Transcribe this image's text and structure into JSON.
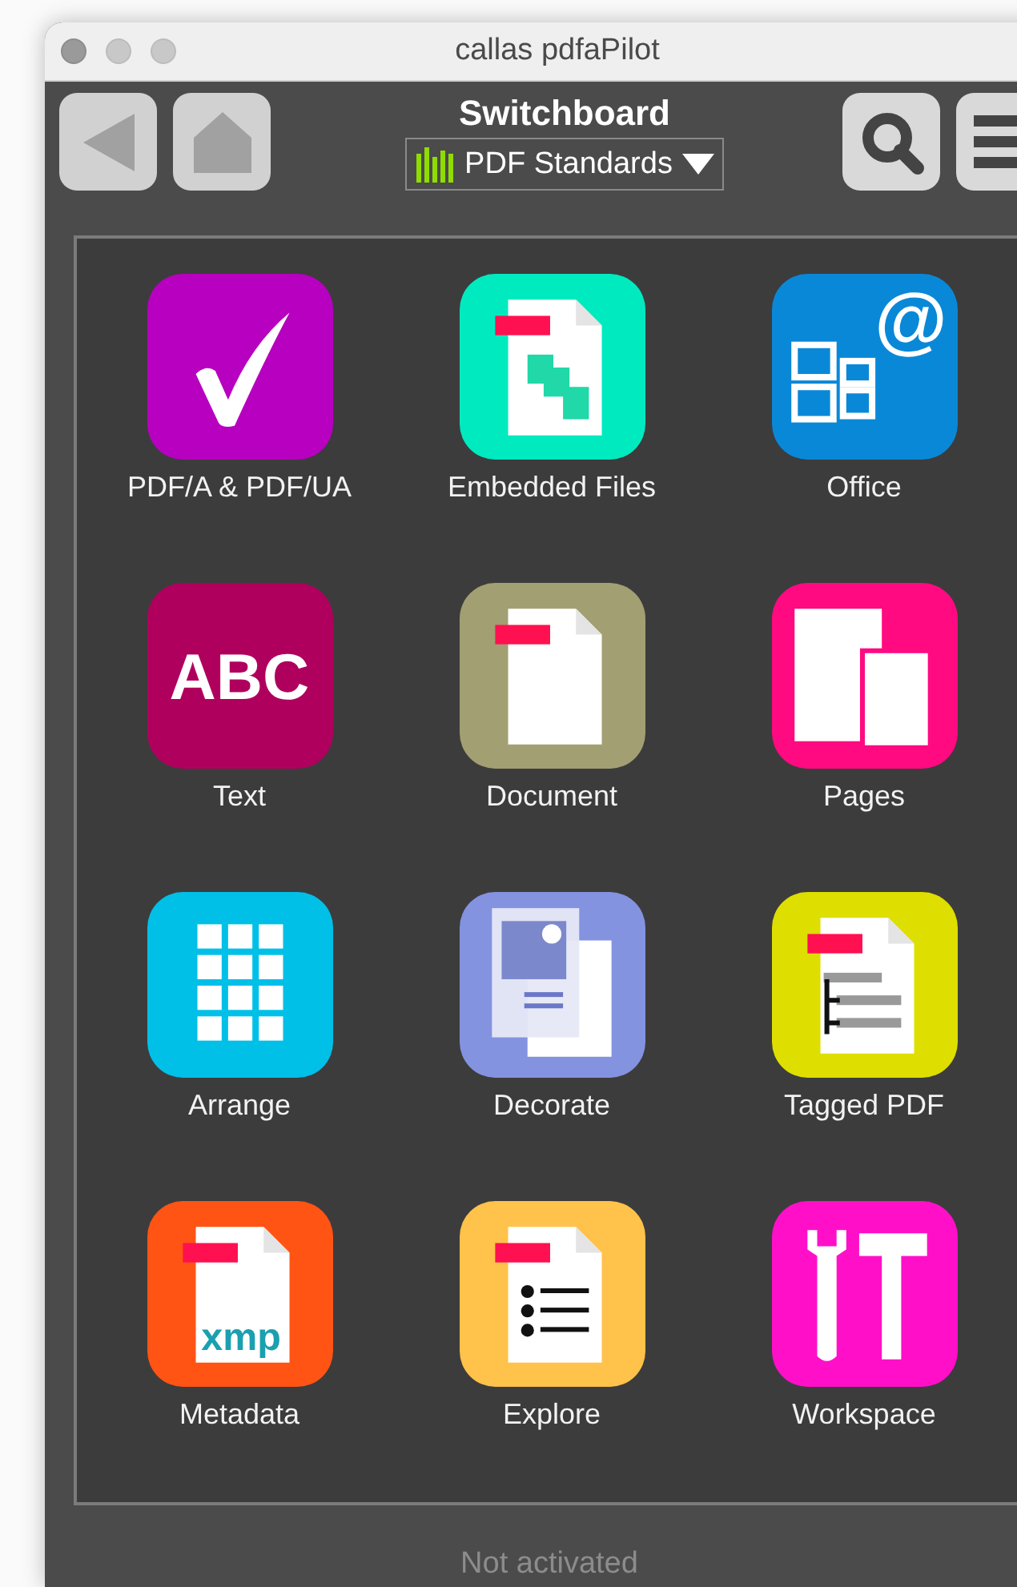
{
  "window": {
    "title": "callas pdfaPilot"
  },
  "toolbar": {
    "title": "Switchboard",
    "profile_menu": {
      "label": "PDF Standards"
    },
    "buttons": [
      {
        "kind": "back",
        "disabled": true
      },
      {
        "kind": "home",
        "disabled": true
      },
      {
        "kind": "search",
        "disabled": false
      },
      {
        "kind": "menu",
        "disabled": false
      }
    ]
  },
  "tiles": [
    {
      "label": "PDF/A & PDF/UA",
      "kind": "check",
      "color": "#b800c0"
    },
    {
      "label": "Embedded Files",
      "kind": "embedded",
      "color": "#00eac0"
    },
    {
      "label": "Office",
      "kind": "office",
      "color": "#0a88d8",
      "icon_text": "@"
    },
    {
      "label": "Text",
      "kind": "text",
      "color": "#b0005e",
      "icon_text": "ABC"
    },
    {
      "label": "Document",
      "kind": "document",
      "color": "#a29f72"
    },
    {
      "label": "Pages",
      "kind": "pages",
      "color": "#ff0a80"
    },
    {
      "label": "Arrange",
      "kind": "arrange",
      "color": "#00c0e8"
    },
    {
      "label": "Decorate",
      "kind": "decorate",
      "color": "#8493e0"
    },
    {
      "label": "Tagged PDF",
      "kind": "tagged",
      "color": "#dede00"
    },
    {
      "label": "Metadata",
      "kind": "metadata",
      "color": "#ff5414",
      "icon_text": "xmp"
    },
    {
      "label": "Explore",
      "kind": "explore",
      "color": "#ffc24a"
    },
    {
      "label": "Workspace",
      "kind": "workspace",
      "color": "#ff10c8"
    }
  ],
  "status_bar": {
    "text": "Not activated"
  }
}
